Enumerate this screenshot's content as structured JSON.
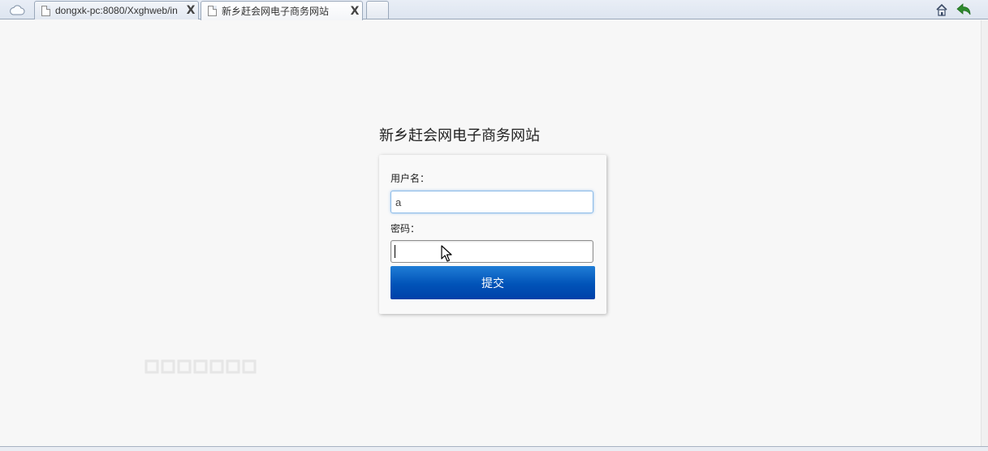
{
  "browser": {
    "tabs": [
      {
        "title": "dongxk-pc:8080/Xxghweb/in",
        "active": false
      },
      {
        "title": "新乡赶会网电子商务网站",
        "active": true
      }
    ],
    "close_glyph": "X",
    "icons": [
      "cloud-icon",
      "page-icon",
      "home-icon",
      "back-arrow-icon"
    ],
    "accent_color": "#2e8b2e"
  },
  "page": {
    "title": "新乡赶会网电子商务网站",
    "form": {
      "username_label": "用户名：",
      "username_value": "a",
      "password_label": "密码：",
      "password_value": "",
      "submit_label": "提交"
    },
    "button_color": "#0153b8"
  }
}
